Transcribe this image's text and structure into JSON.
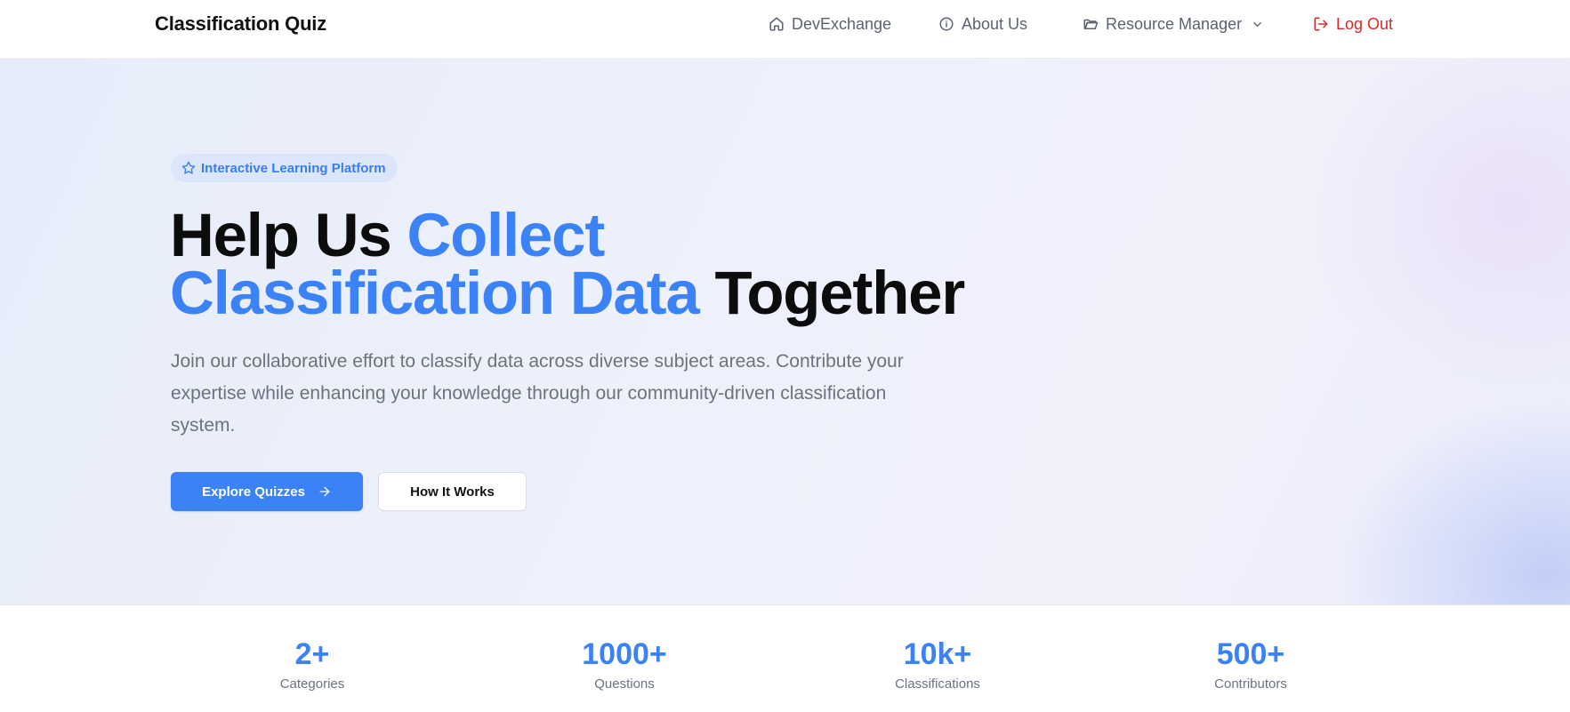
{
  "nav": {
    "brand": "Classification Quiz",
    "items": [
      {
        "label": "DevExchange",
        "icon": "home-icon"
      },
      {
        "label": "About Us",
        "icon": "info-icon"
      },
      {
        "label": "Resource Manager",
        "icon": "folder-icon"
      },
      {
        "label": "Log Out",
        "icon": "logout-icon"
      }
    ]
  },
  "hero": {
    "badge": "Interactive Learning Platform",
    "headline": {
      "part1": "Help Us ",
      "highlight1": "Collect",
      "highlight2": "Classification Data",
      "part2": " Together"
    },
    "subtext": "Join our collaborative effort to classify data across diverse subject areas. Contribute your expertise while enhancing your knowledge through our community-driven classification system.",
    "primary_button": "Explore Quizzes",
    "secondary_button": "How It Works"
  },
  "stats": [
    {
      "value": "2+",
      "label": "Categories"
    },
    {
      "value": "1000+",
      "label": "Questions"
    },
    {
      "value": "10k+",
      "label": "Classifications"
    },
    {
      "value": "500+",
      "label": "Contributors"
    }
  ],
  "colors": {
    "accent": "#3b82f6",
    "logout": "#dc2626",
    "muted_text": "#6b7280",
    "badge_bg": "#dbe6fb"
  }
}
